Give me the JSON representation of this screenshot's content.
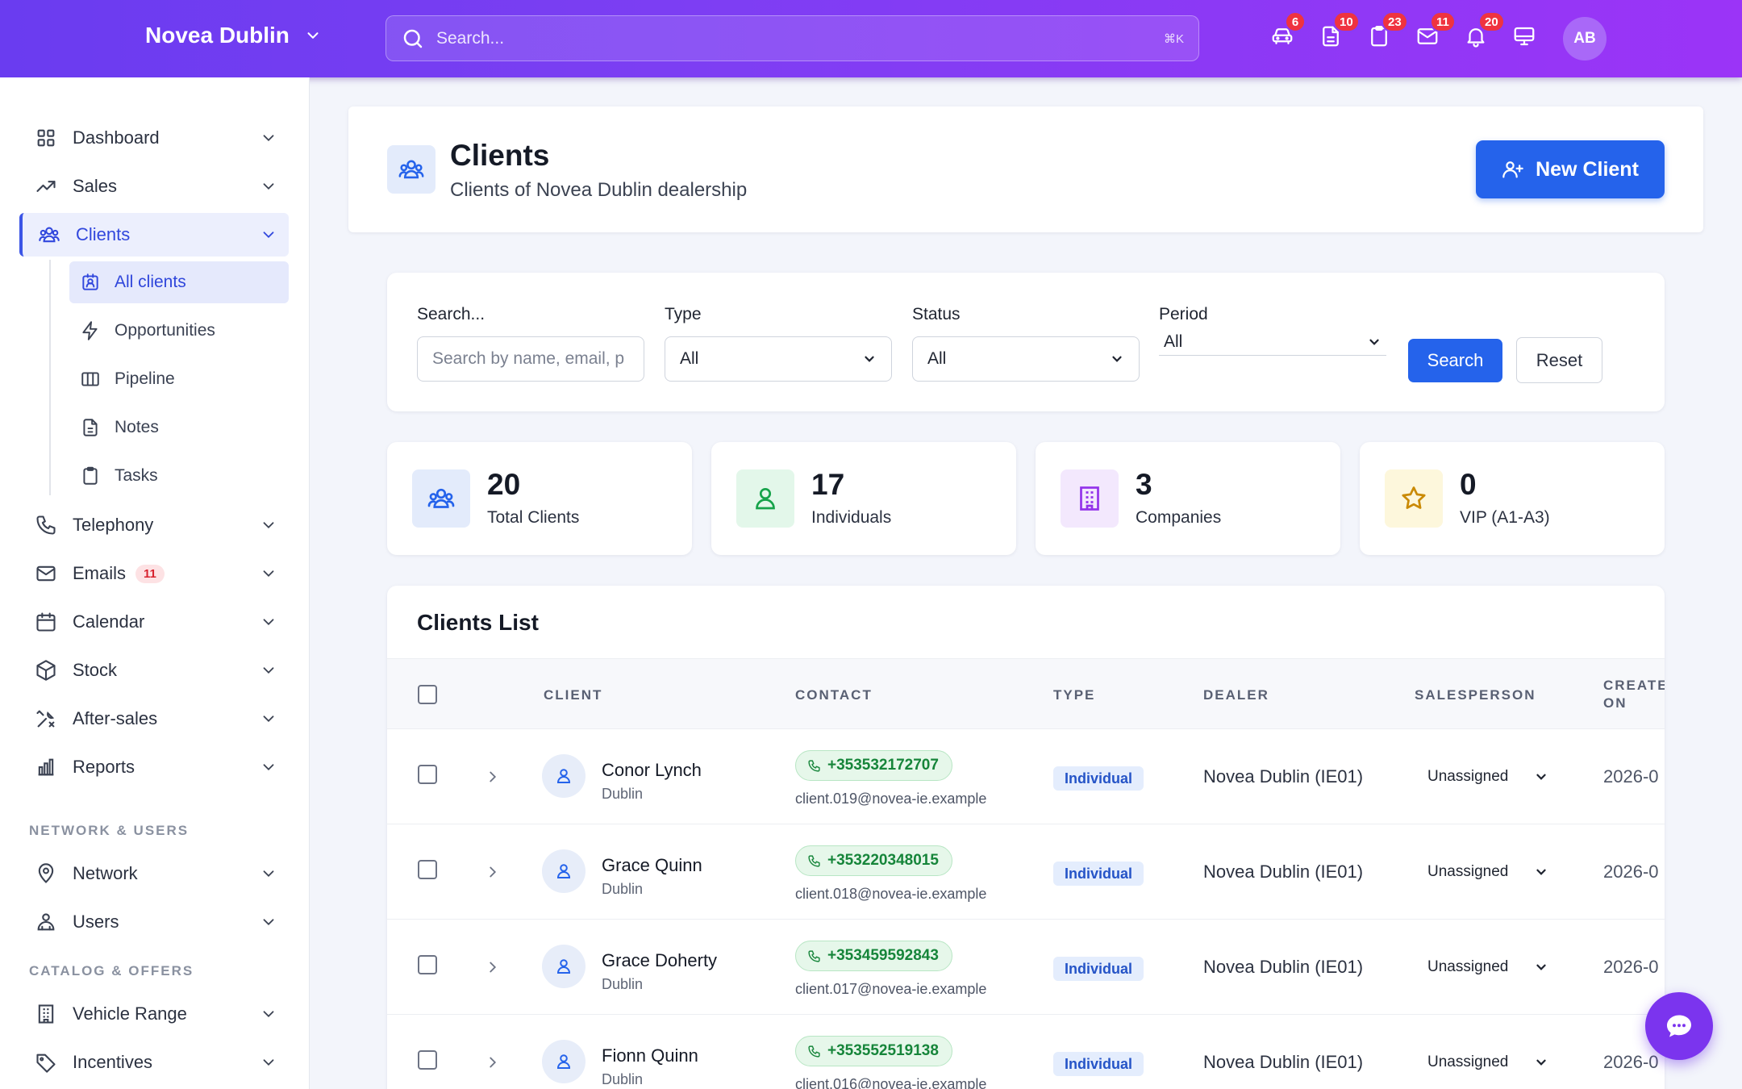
{
  "topbar": {
    "brand": "Novea Dublin",
    "search_placeholder": "Search...",
    "shortcut": "⌘K",
    "icons": [
      {
        "name": "car-icon",
        "badge": "6"
      },
      {
        "name": "document-icon",
        "badge": "10"
      },
      {
        "name": "clipboard-icon",
        "badge": "23"
      },
      {
        "name": "mail-icon",
        "badge": "11"
      },
      {
        "name": "bell-icon",
        "badge": "20"
      },
      {
        "name": "monitor-icon",
        "badge": ""
      }
    ],
    "avatar": "AB"
  },
  "sidebar": {
    "items": [
      {
        "label": "Dashboard",
        "icon": "grid-icon"
      },
      {
        "label": "Sales",
        "icon": "trend-icon"
      },
      {
        "label": "Clients",
        "icon": "users-icon"
      },
      {
        "label": "Telephony",
        "icon": "phone-icon"
      },
      {
        "label": "Emails",
        "icon": "mail-icon",
        "badge": "11"
      },
      {
        "label": "Calendar",
        "icon": "calendar-icon"
      },
      {
        "label": "Stock",
        "icon": "box-icon"
      },
      {
        "label": "After-sales",
        "icon": "tools-icon"
      },
      {
        "label": "Reports",
        "icon": "chart-icon"
      },
      {
        "label": "Network",
        "icon": "pin-icon"
      },
      {
        "label": "Users",
        "icon": "user-group-icon"
      },
      {
        "label": "Vehicle Range",
        "icon": "building-icon"
      },
      {
        "label": "Incentives",
        "icon": "tag-icon"
      }
    ],
    "subitems": [
      {
        "label": "All clients",
        "icon": "contacts-icon"
      },
      {
        "label": "Opportunities",
        "icon": "bolt-icon"
      },
      {
        "label": "Pipeline",
        "icon": "columns-icon"
      },
      {
        "label": "Notes",
        "icon": "note-icon"
      },
      {
        "label": "Tasks",
        "icon": "clipboard-icon"
      }
    ],
    "sections": [
      "NETWORK & USERS",
      "CATALOG & OFFERS"
    ]
  },
  "header": {
    "title": "Clients",
    "subtitle": "Clients of Novea Dublin dealership",
    "new_button": "New Client"
  },
  "filters": {
    "search_label": "Search...",
    "search_placeholder": "Search by name, email, p",
    "type_label": "Type",
    "type_value": "All",
    "status_label": "Status",
    "status_value": "All",
    "period_label": "Period",
    "period_value": "All",
    "search_button": "Search",
    "reset_button": "Reset"
  },
  "stats": [
    {
      "value": "20",
      "label": "Total Clients",
      "icon": "users-icon",
      "color": "#2563eb",
      "bg": "#e3ebfb"
    },
    {
      "value": "17",
      "label": "Individuals",
      "icon": "person-icon",
      "color": "#16a34a",
      "bg": "#e3f7ea"
    },
    {
      "value": "3",
      "label": "Companies",
      "icon": "building-icon",
      "color": "#9333ea",
      "bg": "#f3e8fd"
    },
    {
      "value": "0",
      "label": "VIP (A1-A3)",
      "icon": "star-icon",
      "color": "#ca8a04",
      "bg": "#fdf7dc"
    }
  ],
  "list": {
    "title": "Clients List",
    "columns": [
      "CLIENT",
      "CONTACT",
      "TYPE",
      "DEALER",
      "SALESPERSON",
      "CREATE",
      "ON"
    ],
    "rows": [
      {
        "name": "Conor Lynch",
        "city": "Dublin",
        "phone": "+353532172707",
        "email": "client.019@novea-ie.example",
        "type": "Individual",
        "dealer": "Novea Dublin (IE01)",
        "salesperson": "Unassigned",
        "created": "2026-0"
      },
      {
        "name": "Grace Quinn",
        "city": "Dublin",
        "phone": "+353220348015",
        "email": "client.018@novea-ie.example",
        "type": "Individual",
        "dealer": "Novea Dublin (IE01)",
        "salesperson": "Unassigned",
        "created": "2026-0"
      },
      {
        "name": "Grace Doherty",
        "city": "Dublin",
        "phone": "+353459592843",
        "email": "client.017@novea-ie.example",
        "type": "Individual",
        "dealer": "Novea Dublin (IE01)",
        "salesperson": "Unassigned",
        "created": "2026-0"
      },
      {
        "name": "Fionn Quinn",
        "city": "Dublin",
        "phone": "+353552519138",
        "email": "client.016@novea-ie.example",
        "type": "Individual",
        "dealer": "Novea Dublin (IE01)",
        "salesperson": "Unassigned",
        "created": "2026-0"
      }
    ]
  },
  "colors": {
    "accent": "#2563eb",
    "brand_gradient_start": "#6a3cf0",
    "brand_gradient_end": "#9b34f7",
    "badge": "#ef3340"
  }
}
